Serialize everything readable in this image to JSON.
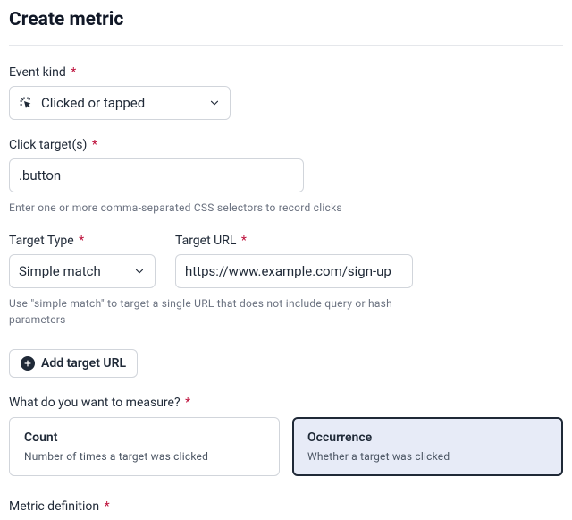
{
  "page_title": "Create metric",
  "required_mark": "*",
  "fields": {
    "event_kind": {
      "label": "Event kind",
      "value": "Clicked or tapped"
    },
    "click_targets": {
      "label": "Click target(s)",
      "value": ".button",
      "help": "Enter one or more comma-separated CSS selectors to record clicks"
    },
    "target_type": {
      "label": "Target Type",
      "value": "Simple match"
    },
    "target_url": {
      "label": "Target URL",
      "value": "https://www.example.com/sign-up"
    },
    "target_type_help": "Use \"simple match\" to target a single URL that does not include query or hash parameters",
    "add_target_url": "Add target URL"
  },
  "measure": {
    "label": "What do you want to measure?",
    "options": [
      {
        "title": "Count",
        "desc": "Number of times a target was clicked"
      },
      {
        "title": "Occurrence",
        "desc": "Whether a target was clicked"
      }
    ]
  },
  "metric_definition_label": "Metric definition"
}
